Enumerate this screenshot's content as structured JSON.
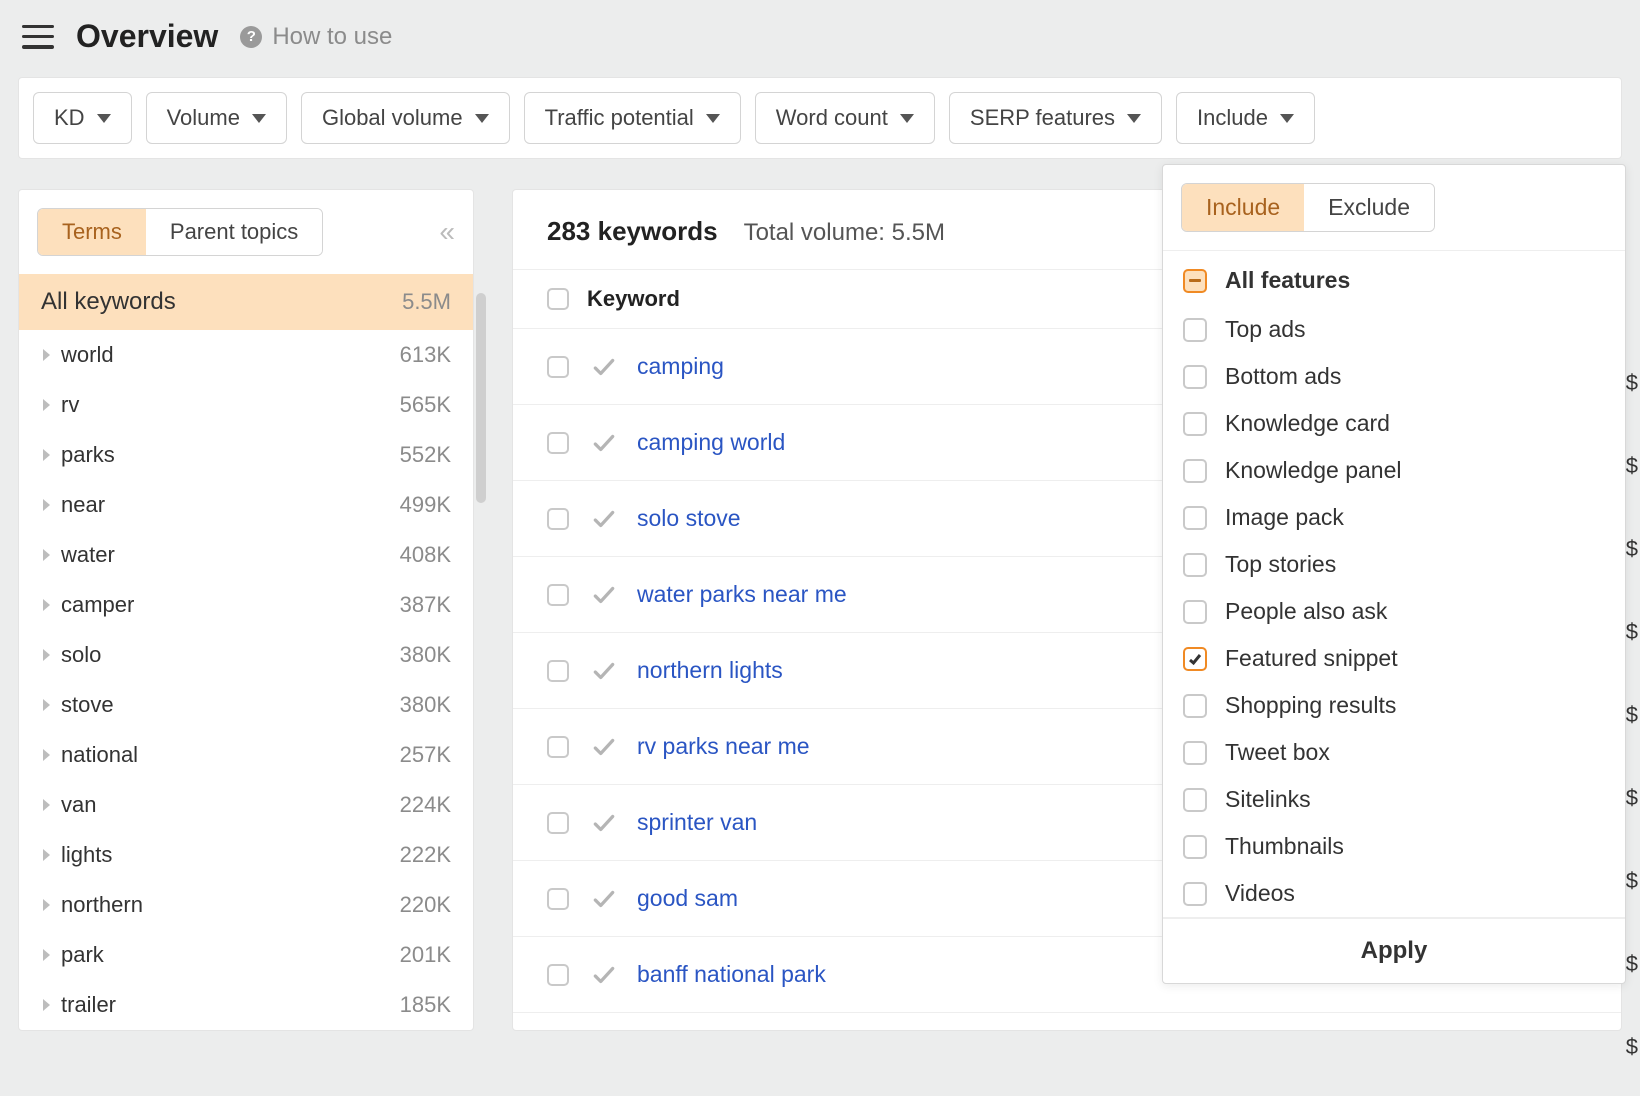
{
  "header": {
    "title": "Overview",
    "how_to_use": "How to use"
  },
  "filters": [
    {
      "label": "KD"
    },
    {
      "label": "Volume"
    },
    {
      "label": "Global volume"
    },
    {
      "label": "Traffic potential"
    },
    {
      "label": "Word count"
    },
    {
      "label": "SERP features"
    },
    {
      "label": "Include"
    }
  ],
  "sidebar": {
    "tabs": {
      "terms": "Terms",
      "parent": "Parent topics"
    },
    "all_label": "All keywords",
    "all_count": "5.5M",
    "items": [
      {
        "name": "world",
        "count": "613K"
      },
      {
        "name": "rv",
        "count": "565K"
      },
      {
        "name": "parks",
        "count": "552K"
      },
      {
        "name": "near",
        "count": "499K"
      },
      {
        "name": "water",
        "count": "408K"
      },
      {
        "name": "camper",
        "count": "387K"
      },
      {
        "name": "solo",
        "count": "380K"
      },
      {
        "name": "stove",
        "count": "380K"
      },
      {
        "name": "national",
        "count": "257K"
      },
      {
        "name": "van",
        "count": "224K"
      },
      {
        "name": "lights",
        "count": "222K"
      },
      {
        "name": "northern",
        "count": "220K"
      },
      {
        "name": "park",
        "count": "201K"
      },
      {
        "name": "trailer",
        "count": "185K"
      }
    ]
  },
  "table": {
    "count_label": "283 keywords",
    "total_label": "Total volume: 5.5M",
    "header_keyword": "Keyword",
    "rows": [
      {
        "keyword": "camping"
      },
      {
        "keyword": "camping world"
      },
      {
        "keyword": "solo stove"
      },
      {
        "keyword": "water parks near me"
      },
      {
        "keyword": "northern lights"
      },
      {
        "keyword": "rv parks near me"
      },
      {
        "keyword": "sprinter van"
      },
      {
        "keyword": "good sam"
      },
      {
        "keyword": "banff national park"
      }
    ]
  },
  "dropdown": {
    "include": "Include",
    "exclude": "Exclude",
    "all_features": "All features",
    "apply": "Apply",
    "options": [
      {
        "label": "Top ads",
        "checked": false
      },
      {
        "label": "Bottom ads",
        "checked": false
      },
      {
        "label": "Knowledge card",
        "checked": false
      },
      {
        "label": "Knowledge panel",
        "checked": false
      },
      {
        "label": "Image pack",
        "checked": false
      },
      {
        "label": "Top stories",
        "checked": false
      },
      {
        "label": "People also ask",
        "checked": false
      },
      {
        "label": "Featured snippet",
        "checked": true
      },
      {
        "label": "Shopping results",
        "checked": false
      },
      {
        "label": "Tweet box",
        "checked": false
      },
      {
        "label": "Sitelinks",
        "checked": false
      },
      {
        "label": "Thumbnails",
        "checked": false
      },
      {
        "label": "Videos",
        "checked": false
      }
    ]
  },
  "currency_symbol": "$"
}
